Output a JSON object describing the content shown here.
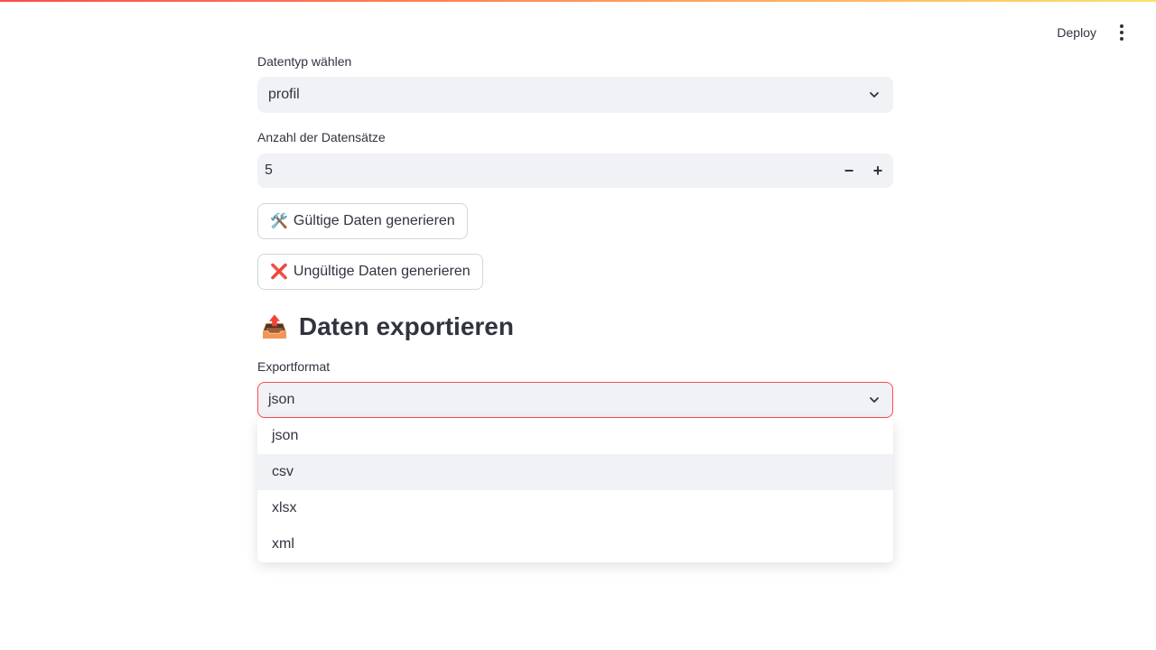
{
  "header": {
    "deploy_label": "Deploy",
    "menu_icon": "kebab-menu-icon"
  },
  "datatype": {
    "label": "Datentyp wählen",
    "value": "profil"
  },
  "count": {
    "label": "Anzahl der Datensätze",
    "value": "5",
    "decrement": "−",
    "increment": "+"
  },
  "buttons": {
    "valid": {
      "emoji": "🛠️",
      "label": "Gültige Daten generieren"
    },
    "invalid": {
      "emoji": "❌",
      "label": "Ungültige Daten generieren"
    }
  },
  "export": {
    "heading_emoji": "📤",
    "heading": "Daten exportieren",
    "format_label": "Exportformat",
    "format_value": "json",
    "options": [
      "json",
      "csv",
      "xlsx",
      "xml"
    ],
    "hovered_option": "csv"
  },
  "colors": {
    "accent": "#ff4b4b",
    "input_bg": "#f0f2f6",
    "text": "#31333f"
  }
}
